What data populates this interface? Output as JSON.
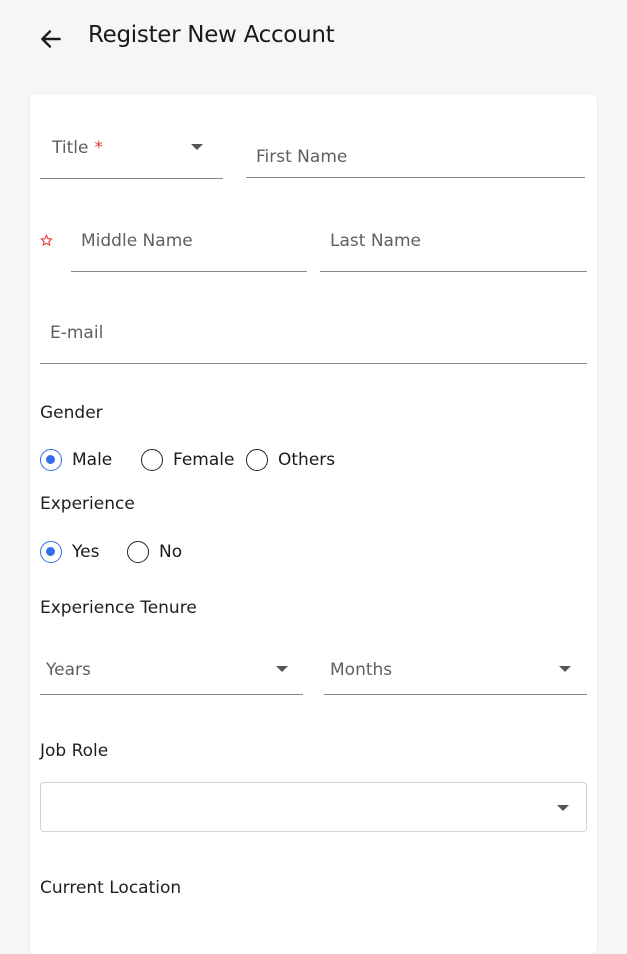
{
  "header": {
    "title": "Register New Account",
    "back_icon": "arrow-left-icon"
  },
  "form": {
    "title_field": {
      "label": "Title",
      "required_mark": "*"
    },
    "first_name": {
      "placeholder": "First Name"
    },
    "middle_name": {
      "placeholder": "Middle Name",
      "icon": "star-outline-icon"
    },
    "last_name": {
      "placeholder": "Last Name"
    },
    "email": {
      "placeholder": "E-mail"
    },
    "gender": {
      "label": "Gender",
      "options": [
        "Male",
        "Female",
        "Others"
      ],
      "selected": "Male"
    },
    "experience": {
      "label": "Experience",
      "options": [
        "Yes",
        "No"
      ],
      "selected": "Yes"
    },
    "tenure": {
      "label": "Experience Tenure",
      "years_placeholder": "Years",
      "months_placeholder": "Months"
    },
    "job_role": {
      "label": "Job Role",
      "value": ""
    },
    "current_location": {
      "label": "Current Location"
    }
  },
  "colors": {
    "accent": "#2f6ee8",
    "required": "#e53935",
    "background": "#f6f6f6"
  }
}
